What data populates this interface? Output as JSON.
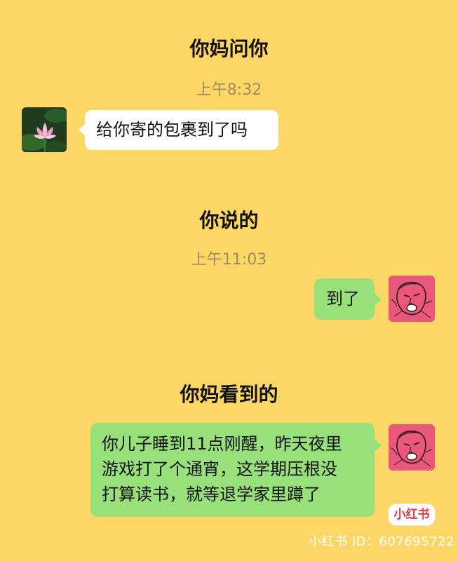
{
  "sections": [
    {
      "heading": "你妈问你",
      "time": "上午8:32",
      "message": "给你寄的包裹到了吗"
    },
    {
      "heading": "你说的",
      "time": "上午11:03",
      "message": "到了"
    },
    {
      "heading": "你妈看到的",
      "message_lines": [
        "你儿子睡到11点刚醒，昨天夜里",
        "游戏打了个通宵，这学期压根没",
        "打算读书，就等退学家里蹲了"
      ]
    }
  ],
  "watermark": {
    "logo_text": "小红书",
    "id_text": "小红书 ID：607695722"
  },
  "colors": {
    "background": "#fcd766",
    "bubble_left": "#ffffff",
    "bubble_right": "#98e07a",
    "avatar_right": "#e9577a",
    "logo_red": "#e33a45"
  },
  "icons": {
    "mom_avatar": "lotus-avatar-icon",
    "son_avatar": "sketch-face-avatar-icon"
  }
}
